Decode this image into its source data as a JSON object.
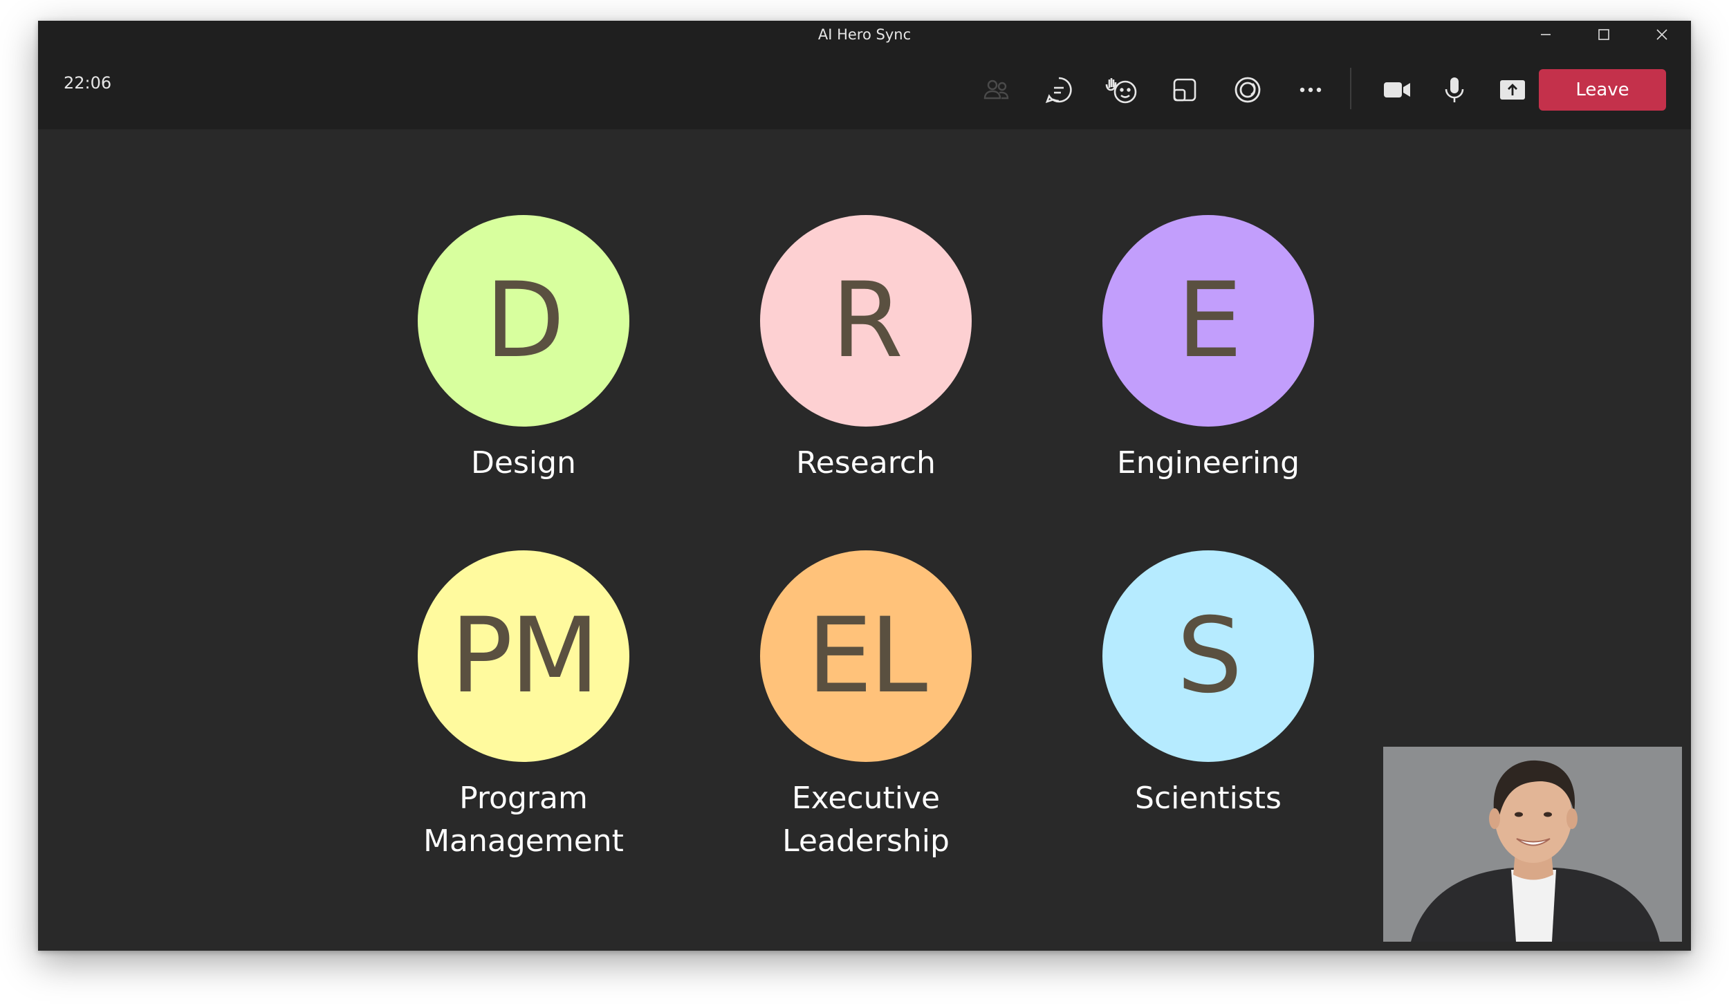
{
  "window": {
    "title": "AI Hero Sync"
  },
  "toolbar": {
    "time": "22:06",
    "leave_label": "Leave"
  },
  "participants": [
    {
      "initials": "D",
      "label": "Design",
      "color": "#d8ff9e"
    },
    {
      "initials": "R",
      "label": "Research",
      "color": "#fdd0d2"
    },
    {
      "initials": "E",
      "label": "Engineering",
      "color": "#c29efc"
    },
    {
      "initials": "PM",
      "label": "Program\nManagement",
      "color": "#fffa9e"
    },
    {
      "initials": "EL",
      "label": "Executive\nLeadership",
      "color": "#ffc27a"
    },
    {
      "initials": "S",
      "label": "Scientists",
      "color": "#b6ebff"
    }
  ],
  "icons": {
    "people": "people-icon",
    "chat": "chat-icon",
    "react": "raise-hand-icon",
    "rooms": "rooms-icon",
    "apps": "apps-icon",
    "more": "more-icon",
    "camera": "camera-icon",
    "mic": "microphone-icon",
    "share": "share-icon"
  },
  "colors": {
    "leave": "#c4314b",
    "background": "#292929"
  }
}
